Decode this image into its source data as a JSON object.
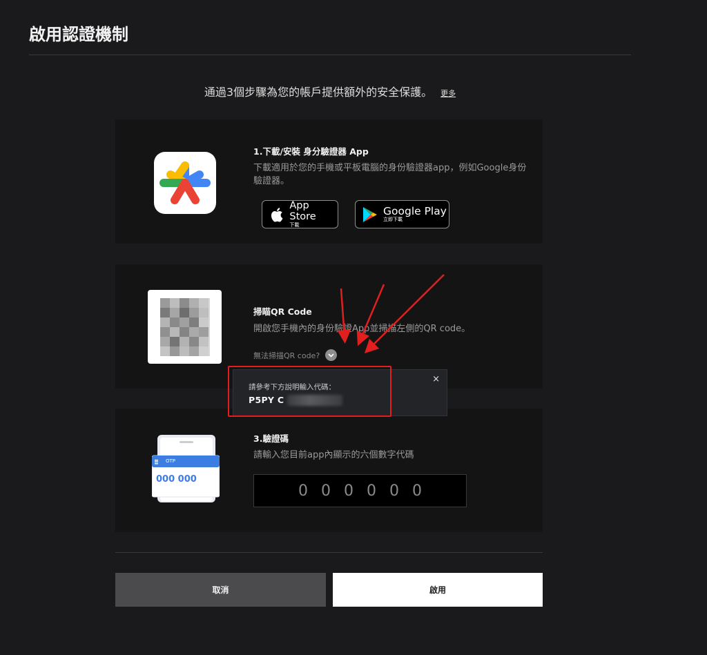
{
  "page": {
    "title": "啟用認證機制",
    "intro": "通過3個步驟為您的帳戶提供額外的安全保護。",
    "more_link": "更多"
  },
  "step1": {
    "title": "1.下載/安裝 身分驗證器 App",
    "description": "下載適用於您的手機或平板電腦的身份驗證器app，例如Google身份驗證器。",
    "app_store": {
      "label": "App Store",
      "sub": "下載"
    },
    "google_play": {
      "label": "Google Play",
      "sub": "立即下載"
    }
  },
  "step2": {
    "title": "掃瞄QR Code",
    "description": "開啟您手機內的身份驗證App並掃描左側的QR code。",
    "cant_scan": "無法掃描QR code?",
    "popup": {
      "label": "請參考下方說明輸入代碼：",
      "code_visible": "P5PY C",
      "close": "×"
    }
  },
  "step3": {
    "title": "3.驗證碼",
    "description": "請輸入您目前app內顯示的六個數字代碼",
    "otp_illustration": {
      "tag": "OTP",
      "digits": "000 000"
    },
    "otp_placeholder_digits": [
      "0",
      "0",
      "0",
      "0",
      "0",
      "0"
    ]
  },
  "actions": {
    "cancel": "取消",
    "enable": "啟用"
  },
  "colors": {
    "background": "#1a1a1c",
    "card": "#141415",
    "highlight": "#e11f1f",
    "otp_blue": "#3b7de0"
  }
}
